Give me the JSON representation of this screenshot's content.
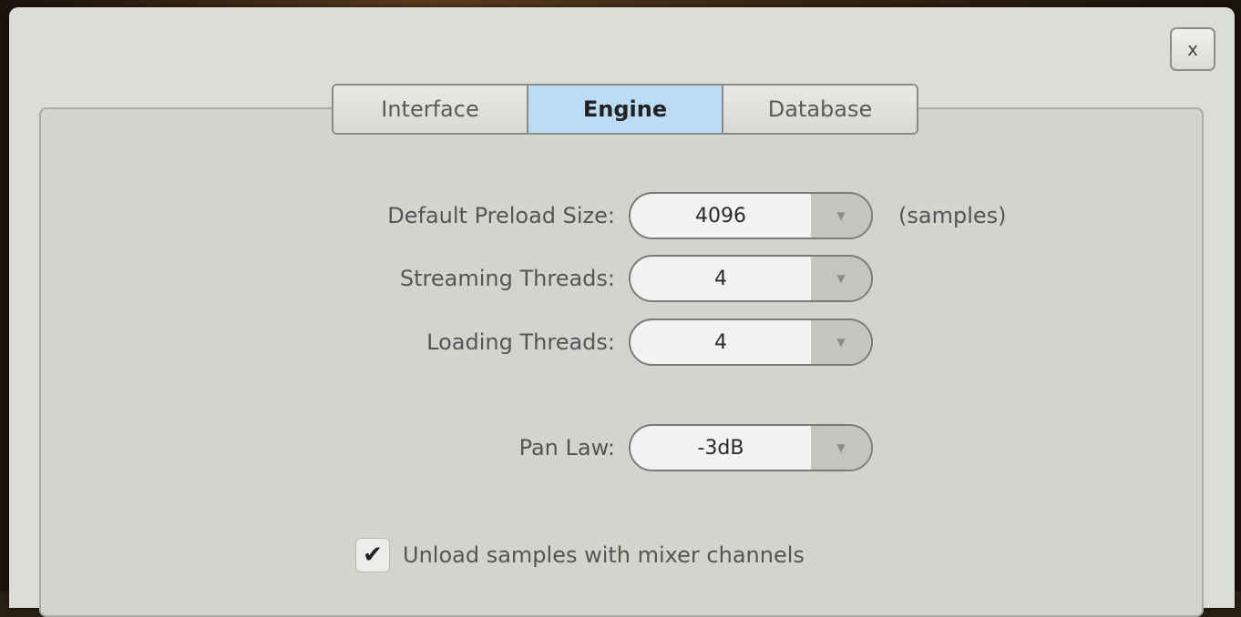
{
  "window": {
    "close_label": "x"
  },
  "tabs": [
    {
      "label": "Interface",
      "active": false
    },
    {
      "label": "Engine",
      "active": true
    },
    {
      "label": "Database",
      "active": false
    }
  ],
  "engine": {
    "preload": {
      "label": "Default Preload Size:",
      "value": "4096",
      "unit": "(samples)"
    },
    "streaming_threads": {
      "label": "Streaming Threads:",
      "value": "4"
    },
    "loading_threads": {
      "label": "Loading Threads:",
      "value": "4"
    },
    "pan_law": {
      "label": "Pan Law:",
      "value": "-3dB"
    },
    "unload_samples": {
      "label": "Unload samples with mixer channels",
      "checked": true,
      "check_glyph": "✔"
    }
  },
  "icons": {
    "dropdown_arrow": "▼"
  },
  "colors": {
    "active_tab": "#bcdcf6",
    "dialog_bg": "#dcdcd8",
    "panel_bg": "#d3d3cf"
  }
}
